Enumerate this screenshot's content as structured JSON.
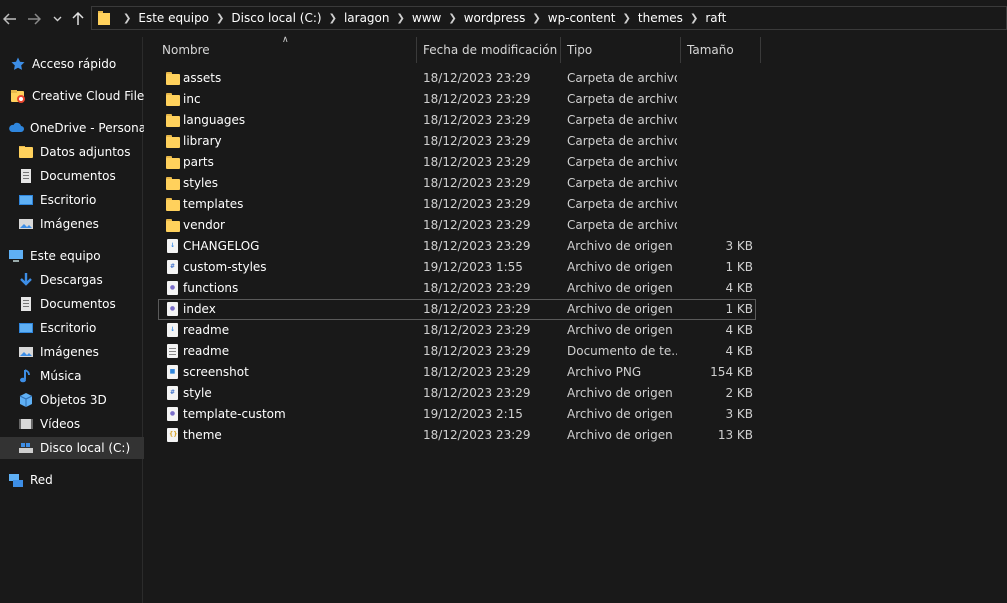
{
  "address": {
    "crumbs": [
      "Este equipo",
      "Disco local (C:)",
      "laragon",
      "www",
      "wordpress",
      "wp-content",
      "themes",
      "raft"
    ]
  },
  "sidebar": {
    "items": [
      {
        "label": "Acceso rápido",
        "icon": "star-icon"
      },
      {
        "label": "Creative Cloud Files",
        "icon": "creative-cloud-icon"
      },
      {
        "label": "OneDrive - Personal",
        "icon": "cloud-icon"
      },
      {
        "label": "Datos adjuntos",
        "icon": "folder-icon"
      },
      {
        "label": "Documentos",
        "icon": "document-icon"
      },
      {
        "label": "Escritorio",
        "icon": "desktop-icon"
      },
      {
        "label": "Imágenes",
        "icon": "pictures-icon"
      },
      {
        "label": "Este equipo",
        "icon": "computer-icon"
      },
      {
        "label": "Descargas",
        "icon": "download-icon"
      },
      {
        "label": "Documentos",
        "icon": "document-icon"
      },
      {
        "label": "Escritorio",
        "icon": "desktop-icon"
      },
      {
        "label": "Imágenes",
        "icon": "pictures-icon"
      },
      {
        "label": "Música",
        "icon": "music-icon"
      },
      {
        "label": "Objetos 3D",
        "icon": "cube-icon"
      },
      {
        "label": "Vídeos",
        "icon": "video-icon"
      },
      {
        "label": "Disco local (C:)",
        "icon": "drive-icon"
      },
      {
        "label": "Red",
        "icon": "network-icon"
      }
    ]
  },
  "columns": {
    "name": "Nombre",
    "date": "Fecha de modificación",
    "type": "Tipo",
    "size": "Tamaño"
  },
  "files": [
    {
      "name": "assets",
      "date": "18/12/2023 23:29",
      "type": "Carpeta de archivos",
      "size": "",
      "icon": "folder-icon"
    },
    {
      "name": "inc",
      "date": "18/12/2023 23:29",
      "type": "Carpeta de archivos",
      "size": "",
      "icon": "folder-icon"
    },
    {
      "name": "languages",
      "date": "18/12/2023 23:29",
      "type": "Carpeta de archivos",
      "size": "",
      "icon": "folder-icon"
    },
    {
      "name": "library",
      "date": "18/12/2023 23:29",
      "type": "Carpeta de archivos",
      "size": "",
      "icon": "folder-icon"
    },
    {
      "name": "parts",
      "date": "18/12/2023 23:29",
      "type": "Carpeta de archivos",
      "size": "",
      "icon": "folder-icon"
    },
    {
      "name": "styles",
      "date": "18/12/2023 23:29",
      "type": "Carpeta de archivos",
      "size": "",
      "icon": "folder-icon"
    },
    {
      "name": "templates",
      "date": "18/12/2023 23:29",
      "type": "Carpeta de archivos",
      "size": "",
      "icon": "folder-icon"
    },
    {
      "name": "vendor",
      "date": "18/12/2023 23:29",
      "type": "Carpeta de archivos",
      "size": "",
      "icon": "folder-icon"
    },
    {
      "name": "CHANGELOG",
      "date": "18/12/2023 23:29",
      "type": "Archivo de origen ...",
      "size": "3 KB",
      "icon": "markdown-file-icon"
    },
    {
      "name": "custom-styles",
      "date": "19/12/2023 1:55",
      "type": "Archivo de origen ...",
      "size": "1 KB",
      "icon": "css-file-icon"
    },
    {
      "name": "functions",
      "date": "18/12/2023 23:29",
      "type": "Archivo de origen ...",
      "size": "4 KB",
      "icon": "php-file-icon"
    },
    {
      "name": "index",
      "date": "18/12/2023 23:29",
      "type": "Archivo de origen ...",
      "size": "1 KB",
      "icon": "php-file-icon"
    },
    {
      "name": "readme",
      "date": "18/12/2023 23:29",
      "type": "Archivo de origen ...",
      "size": "4 KB",
      "icon": "markdown-file-icon"
    },
    {
      "name": "readme",
      "date": "18/12/2023 23:29",
      "type": "Documento de te...",
      "size": "4 KB",
      "icon": "text-file-icon"
    },
    {
      "name": "screenshot",
      "date": "18/12/2023 23:29",
      "type": "Archivo PNG",
      "size": "154 KB",
      "icon": "image-file-icon"
    },
    {
      "name": "style",
      "date": "18/12/2023 23:29",
      "type": "Archivo de origen ...",
      "size": "2 KB",
      "icon": "css-file-icon"
    },
    {
      "name": "template-custom",
      "date": "19/12/2023 2:15",
      "type": "Archivo de origen ...",
      "size": "3 KB",
      "icon": "php-file-icon"
    },
    {
      "name": "theme",
      "date": "18/12/2023 23:29",
      "type": "Archivo de origen ...",
      "size": "13 KB",
      "icon": "json-file-icon"
    }
  ]
}
